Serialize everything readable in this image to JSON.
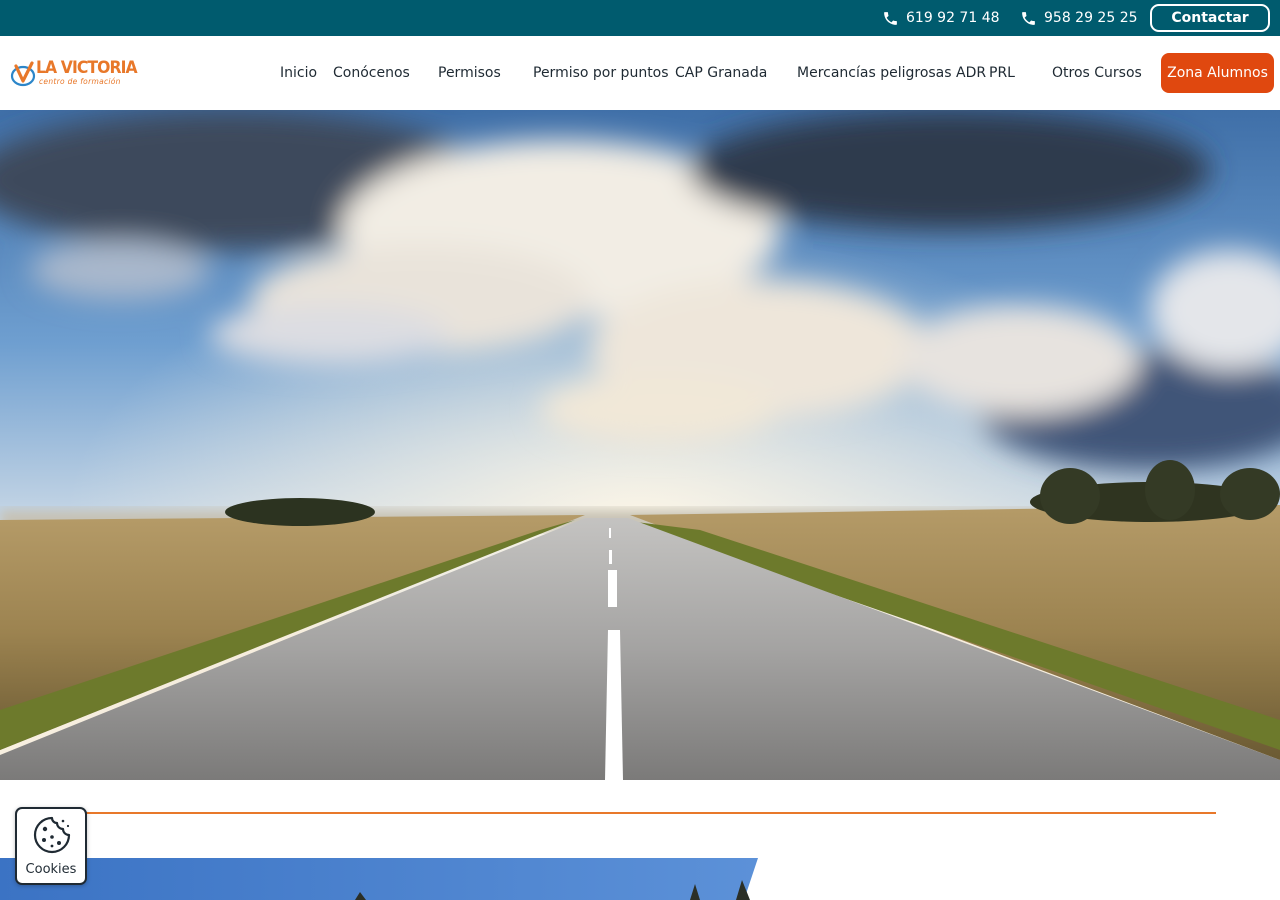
{
  "topbar": {
    "phones": [
      {
        "number": "619 92 71 48",
        "icon": "phone-icon"
      },
      {
        "number": "958 29 25 25",
        "icon": "phone-icon"
      }
    ],
    "contact_label": "Contactar"
  },
  "brand": {
    "logo_title": "LA VICTORIA",
    "logo_subtitle": "centro de formación",
    "accent": "#e8782a",
    "topbar_color": "#005b6e",
    "cta_color": "#e0480f"
  },
  "nav": {
    "items": [
      {
        "label": "Inicio"
      },
      {
        "label": "Conócenos"
      },
      {
        "label": "Permisos"
      },
      {
        "label": "Permiso por puntos"
      },
      {
        "label": "CAP Granada"
      },
      {
        "label": "Mercancías peligrosas ADR"
      },
      {
        "label": "PRL"
      },
      {
        "label": "Otros Cursos"
      }
    ],
    "cta_label": "Zona Alumnos"
  },
  "hero": {
    "image": "open-road-landscape-photo"
  },
  "cookies": {
    "label": "Cookies",
    "icon": "cookie-icon"
  }
}
